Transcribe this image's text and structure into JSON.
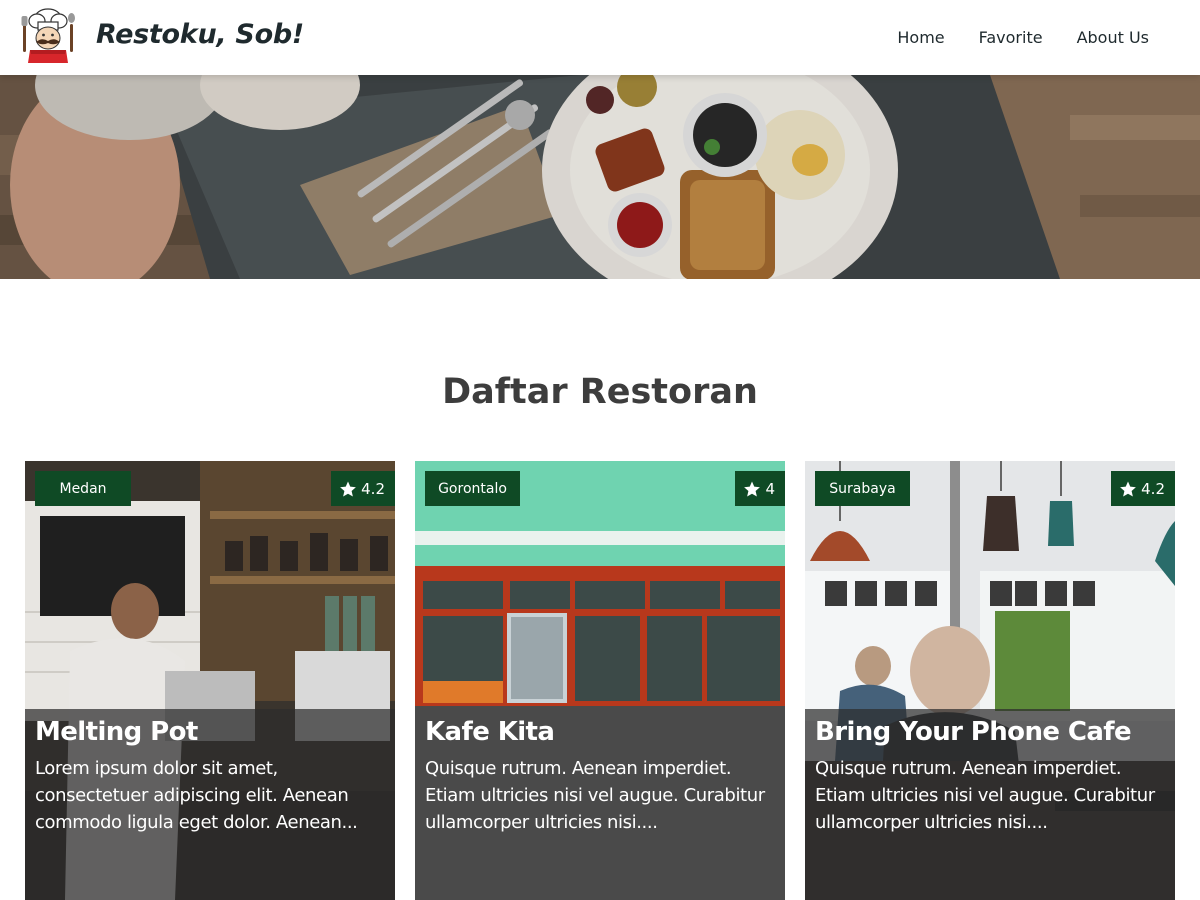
{
  "app": {
    "brand": "Restoku, Sob!",
    "logo_icon": "chef-mustache-logo"
  },
  "nav": {
    "items": [
      {
        "label": "Home"
      },
      {
        "label": "Favorite"
      },
      {
        "label": "About Us"
      }
    ]
  },
  "hero": {
    "image": "breakfast-table-hero-image"
  },
  "section": {
    "title": "Daftar Restoran"
  },
  "restaurants": [
    {
      "city": "Medan",
      "rating": "4.2",
      "name": "Melting Pot",
      "description": "Lorem ipsum dolor sit amet, consectetuer adipiscing elit. Aenean commodo ligula eget dolor. Aenean...",
      "image": "barista-coffee-bar-image"
    },
    {
      "city": "Gorontalo",
      "rating": "4",
      "name": "Kafe Kita",
      "description": "Quisque rutrum. Aenean imperdiet. Etiam ultricies nisi vel augue. Curabitur ullamcorper ultricies nisi....",
      "image": "green-storefront-image"
    },
    {
      "city": "Surabaya",
      "rating": "4.2",
      "name": "Bring Your Phone Cafe",
      "description": "Quisque rutrum. Aenean imperdiet. Etiam ultricies nisi vel augue. Curabitur ullamcorper ultricies nisi....",
      "image": "cafe-interior-pendant-lamps-image"
    }
  ],
  "colors": {
    "tag_bg": "#0f4a25",
    "overlay": "#2d2d2d",
    "heading": "#3d3d3d",
    "nav_text": "#1f2a2e"
  }
}
